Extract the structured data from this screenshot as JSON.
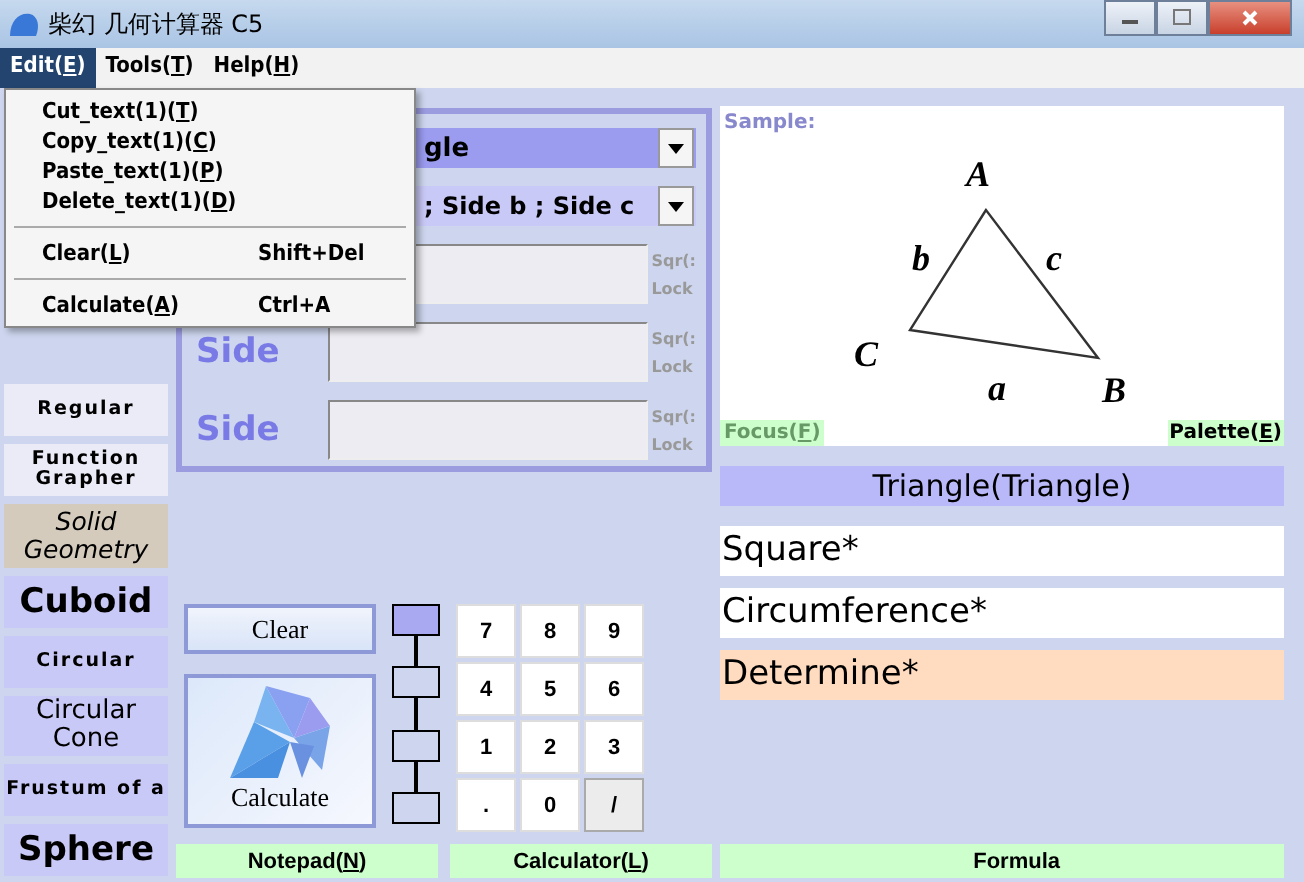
{
  "window": {
    "title": "柴幻 几何计算器 C5"
  },
  "menu": [
    {
      "before": "Edit(",
      "key": "E",
      "after": ")",
      "selected": true
    },
    {
      "before": "Tools(",
      "key": "T",
      "after": ")",
      "selected": false
    },
    {
      "before": "Help(",
      "key": "H",
      "after": ")",
      "selected": false
    }
  ],
  "dropdown": [
    {
      "kind": "item",
      "before": "Cut_text(1)(",
      "key": "T",
      "after": ")"
    },
    {
      "kind": "item",
      "before": "Copy_text(1)(",
      "key": "C",
      "after": ")"
    },
    {
      "kind": "item",
      "before": "Paste_text(1)(",
      "key": "P",
      "after": ")"
    },
    {
      "kind": "item",
      "before": "Delete_text(1)(",
      "key": "D",
      "after": ")"
    },
    {
      "kind": "separator"
    },
    {
      "kind": "item",
      "before": "Clear(",
      "key": "L",
      "after": ")",
      "shortcut": "Shift+Del"
    },
    {
      "kind": "separator"
    },
    {
      "kind": "item",
      "before": "Calculate(",
      "key": "A",
      "after": ")",
      "shortcut": "Ctrl+A"
    }
  ],
  "sidebar": {
    "items": [
      {
        "kind": "small",
        "label": "Regular"
      },
      {
        "kind": "small",
        "label": "Function Grapher"
      },
      {
        "kind": "header",
        "label": "Solid Geometry"
      },
      {
        "kind": "large",
        "label": "Cuboid"
      },
      {
        "kind": "small",
        "label": "Circular"
      },
      {
        "kind": "medium",
        "label": "Circular Cone"
      },
      {
        "kind": "small",
        "label": "Frustum of a"
      },
      {
        "kind": "large",
        "label": "Sphere"
      }
    ]
  },
  "shape_select": {
    "value": "gle"
  },
  "input_select": {
    "value": "; Side b ; Side c"
  },
  "inputs": [
    {
      "sqr": "Sqr(:",
      "lock": "Lock"
    },
    {
      "label": "Side",
      "sqr": "Sqr(:",
      "lock": "Lock"
    },
    {
      "label": "Side",
      "sqr": "Sqr(:",
      "lock": "Lock"
    }
  ],
  "clear_button": "Clear",
  "calculate_button": "Calculate",
  "precision_steps": [
    {
      "selected": true
    },
    {
      "selected": false
    },
    {
      "selected": false
    },
    {
      "selected": false
    }
  ],
  "keypad": [
    "7",
    "8",
    "9",
    "4",
    "5",
    "6",
    "1",
    "2",
    "3",
    ".",
    "0",
    "/"
  ],
  "sample": {
    "label": "Sample:",
    "vertices": [
      "A",
      "B",
      "C"
    ],
    "sides": [
      "a",
      "b",
      "c"
    ],
    "focus": {
      "before": "Focus(",
      "key": "F",
      "after": ")"
    },
    "palette": {
      "before": "Palette(",
      "key": "E",
      "after": ")"
    }
  },
  "shape_title": "Triangle(Triangle)",
  "results": [
    {
      "label": "Square*",
      "highlight": false
    },
    {
      "label": "Circumference*",
      "highlight": false
    },
    {
      "label": "Determine*",
      "highlight": true
    }
  ],
  "bottom_tabs": [
    {
      "before": "Notepad(",
      "key": "N",
      "after": ")"
    },
    {
      "before": "Calculator(",
      "key": "L",
      "after": ")"
    },
    {
      "before": "Formula"
    }
  ]
}
